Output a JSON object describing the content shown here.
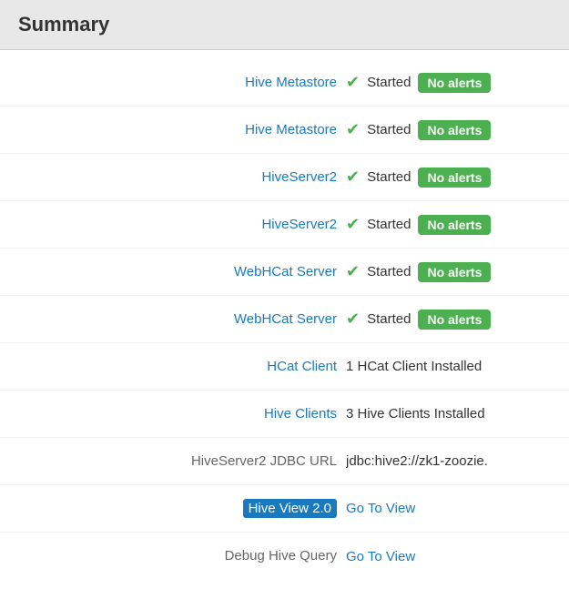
{
  "header": {
    "title": "Summary"
  },
  "rows": [
    {
      "id": "hive-metastore-1",
      "label": "Hive Metastore",
      "label_type": "link",
      "status_icon": "✔",
      "status_text": "Started",
      "badge": "No alerts",
      "badge_type": "no-alerts"
    },
    {
      "id": "hive-metastore-2",
      "label": "Hive Metastore",
      "label_type": "link",
      "status_icon": "✔",
      "status_text": "Started",
      "badge": "No alerts",
      "badge_type": "no-alerts"
    },
    {
      "id": "hiveserver2-1",
      "label": "HiveServer2",
      "label_type": "link",
      "status_icon": "✔",
      "status_text": "Started",
      "badge": "No alerts",
      "badge_type": "no-alerts"
    },
    {
      "id": "hiveserver2-2",
      "label": "HiveServer2",
      "label_type": "link",
      "status_icon": "✔",
      "status_text": "Started",
      "badge": "No alerts",
      "badge_type": "no-alerts"
    },
    {
      "id": "webhcat-server-1",
      "label": "WebHCat Server",
      "label_type": "link",
      "status_icon": "✔",
      "status_text": "Started",
      "badge": "No alerts",
      "badge_type": "no-alerts"
    },
    {
      "id": "webhcat-server-2",
      "label": "WebHCat Server",
      "label_type": "link",
      "status_icon": "✔",
      "status_text": "Started",
      "badge": "No alerts",
      "badge_type": "no-alerts"
    },
    {
      "id": "hcat-client",
      "label": "HCat Client",
      "label_type": "link",
      "status_icon": "",
      "status_text": "1 HCat Client Installed",
      "badge": "",
      "badge_type": "text"
    },
    {
      "id": "hive-clients",
      "label": "Hive Clients",
      "label_type": "link",
      "status_icon": "",
      "status_text": "3 Hive Clients Installed",
      "badge": "",
      "badge_type": "text"
    },
    {
      "id": "hiveserver2-jdbc-url",
      "label": "HiveServer2 JDBC URL",
      "label_type": "plain",
      "status_icon": "",
      "status_text": "jdbc:hive2://zk1-zoozie.",
      "badge": "",
      "badge_type": "text"
    },
    {
      "id": "hive-view-2",
      "label": "Hive View 2.0",
      "label_type": "highlighted",
      "status_icon": "",
      "status_text": "Go To View",
      "badge": "",
      "badge_type": "link"
    },
    {
      "id": "debug-hive-query",
      "label": "Debug Hive Query",
      "label_type": "plain",
      "status_icon": "",
      "status_text": "Go To View",
      "badge": "",
      "badge_type": "link"
    }
  ],
  "labels": {
    "no_alerts": "No alerts",
    "go_to_view": "Go To View",
    "started": "Started"
  },
  "colors": {
    "link": "#1a7abf",
    "badge_green": "#4caf50",
    "highlight_blue": "#1a7abf"
  }
}
